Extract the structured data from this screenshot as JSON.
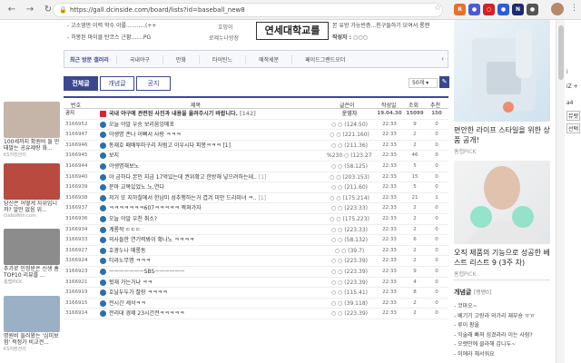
{
  "browser": {
    "url": "https://gall.dcinside.com/board/lists?id=baseball_new8",
    "extensions": [
      {
        "label": "R",
        "color": "#e8712d"
      },
      {
        "label": "●",
        "color": "#4a5bd4"
      },
      {
        "label": "○",
        "color": "#d42222"
      },
      {
        "label": "●",
        "color": "#2b5fd9"
      },
      {
        "label": "N",
        "color": "#1c2b6e"
      },
      {
        "label": "●",
        "color": "#555555"
      }
    ]
  },
  "top_list": {
    "left_items": [
      "- 고소영만 이력 학수 이를...........(++",
      "- 히봉된 마이클 탄코스 근황.......PG"
    ],
    "right_items": [
      "본 유방 가능빈층...친구들하기 모여서 롱캔",
      "작성자 : ○○○"
    ],
    "middle_labels": [
      "호밍이",
      "로제누나방장"
    ],
    "univ_banner": "연세대학교를"
  },
  "recent_bar": {
    "title": "최근 방문 갤러리",
    "items": [
      "국내야구",
      "만화",
      "타이틴느",
      "애작세분",
      "페이드그랜드오더"
    ]
  },
  "tabs": [
    "전체글",
    "개념글",
    "공지"
  ],
  "per_page": "50개",
  "write_icon": "pencil-icon",
  "columns": {
    "no": "번호",
    "subject": "제목",
    "writer": "글쓴이",
    "date": "작성일",
    "views": "조회",
    "rec": "추천"
  },
  "posts": [
    {
      "no": "공지",
      "subject": "국내 야구에 관련된 사진과 내용을 올려주시기 바랍니다.",
      "count": "[142]",
      "writer": "운영자",
      "date": "19.04.30",
      "views": "15099",
      "rec": "150",
      "notice": true
    },
    {
      "no": "3166952",
      "subject": "오늘 야알 우승 보리움잉메포",
      "count": "",
      "writer": "○ ○ (124.50)",
      "date": "22:33",
      "views": "9",
      "rec": "0"
    },
    {
      "no": "3166947",
      "subject": "야생명 존나 이뻐서 사랑 ㅋㅋㅋ",
      "count": "",
      "writer": "○ ○ (221.160)",
      "date": "22:33",
      "views": "2",
      "rec": "0"
    },
    {
      "no": "3166946",
      "subject": "동재호 패배투마구리 처럼고 이우시다 피봉ㅋㅋㅋ [1]",
      "count": "",
      "writer": "○ ○ (211.36)",
      "date": "22:33",
      "views": "2",
      "rec": "0"
    },
    {
      "no": "3166945",
      "subject": "보지",
      "count": "",
      "writer": "%230 ○ (123.274)",
      "date": "22:33",
      "views": "46",
      "rec": "0"
    },
    {
      "no": "3166944",
      "subject": "야생명해보노",
      "count": "",
      "writer": "○ ○ (58.125)",
      "date": "22:33",
      "views": "5",
      "rec": "0"
    },
    {
      "no": "3166940",
      "subject": "야 금하다 본인 지금 17억있는데 권위확고 한방해 넣으려하는데..",
      "count": "[1]",
      "writer": "○ ○ (203.153)",
      "date": "22:33",
      "views": "15",
      "rec": "0"
    },
    {
      "no": "3166939",
      "subject": "문마 교복있었노.노.연다",
      "count": "",
      "writer": "○ ○ (211.60)",
      "date": "22:33",
      "views": "5",
      "rec": "0"
    },
    {
      "no": "3166938",
      "subject": "저거 또 지하철에서 한남미 성추행하는거 겹겨 미만 드리미녀 ㅋ..",
      "count": "[1]",
      "writer": "○ ○ (175.214)",
      "date": "22:33",
      "views": "21",
      "rec": "1"
    },
    {
      "no": "3166937",
      "subject": "ㅋㅋㅋㅋㅋㅋㅋ607ㅋㅋㅋㅋㅋ 짝쳐가자",
      "count": "",
      "writer": "○ ○ (223.33)",
      "date": "22:33",
      "views": "2",
      "rec": "0"
    },
    {
      "no": "3166936",
      "subject": "오늘 야알 우천 취소?",
      "count": "",
      "writer": "○ ○ (175.223)",
      "date": "22:33",
      "views": "2",
      "rec": "0"
    },
    {
      "no": "3166934",
      "subject": "계룡작 ㄷㄷㄷ",
      "count": "",
      "writer": "○ ○ (223.33)",
      "date": "22:33",
      "views": "2",
      "rec": "0"
    },
    {
      "no": "3166933",
      "subject": "의사들한 연기력봐이 확나노 ㅋㅋㅋㅋ",
      "count": "",
      "writer": "○ ○ (58.132)",
      "date": "22:33",
      "views": "6",
      "rec": "0"
    },
    {
      "no": "3166927",
      "subject": "호광누나 메롱동",
      "count": "",
      "writer": "○ ○ (39.7)",
      "date": "22:33",
      "views": "2",
      "rec": "0"
    },
    {
      "no": "3166924",
      "subject": "티라노무명 ㅋㅋㅋ",
      "count": "",
      "writer": "○ ○ (223.39)",
      "date": "22:33",
      "views": "2",
      "rec": "0"
    },
    {
      "no": "3166923",
      "subject": "ㅡㅡㅡㅡㅡㅡㅡSBSㅡㅡㅡㅡㅡㅡ",
      "count": "",
      "writer": "○ ○ (223.39)",
      "date": "22:33",
      "views": "9",
      "rec": "0"
    },
    {
      "no": "3166921",
      "subject": "헛재 가는거냐 ㅋㅋ",
      "count": "",
      "writer": "○ ○ (223.39)",
      "date": "22:33",
      "views": "4",
      "rec": "0"
    },
    {
      "no": "3166919",
      "subject": "호날두두가 찰랑 ㅋㅋㅋㅋ",
      "count": "",
      "writer": "○ ○ (115.41)",
      "date": "22:33",
      "views": "8",
      "rec": "0"
    },
    {
      "no": "3166915",
      "subject": "전시간 세삭ㅋㅋ",
      "count": "",
      "writer": "○ ○ (39.118)",
      "date": "22:33",
      "views": "2",
      "rec": "0"
    },
    {
      "no": "3166914",
      "subject": "전리대 경제 23시간전ㅋㅋㅋㅋㅋ",
      "count": "",
      "writer": "○ ○ (223.39)",
      "date": "22:33",
      "views": "2",
      "rec": "0"
    }
  ],
  "left_ads": [
    {
      "caption": "100세까지 확원비 들 만태말는 공유제랑 화...",
      "source": "KS저장관리",
      "color": "#c4b5a8"
    },
    {
      "caption": "당신은 어떻게 자위입니까? 알만 없음 위...",
      "source": "iSideWith.com",
      "color": "#b84a40"
    },
    {
      "caption": "추가로 인정받은 신생 홈 TOP10 리뷰를 ...",
      "source": "홈랩PICK",
      "color": "#8c8c8c"
    },
    {
      "caption": "명원비 들러왔는 '심미보험' 적정가 비교견...",
      "source": "KS저장관리",
      "color": "#9bb0c4"
    }
  ],
  "right_ads": [
    {
      "title": "편안한 라이프 스타일을 위한 상품 공개!",
      "source": "홈랩PICK"
    },
    {
      "title": "오직 제품의 기능으로 성공한 베스트 리스트 9 (3주 차)",
      "source": "홈랩PICK"
    }
  ],
  "concept": {
    "title": "개념글",
    "sub": "[랭뱅0]",
    "items": [
      "- 코마오~",
      "- 베기기 고랑라 와가리 재부숑 ㅠㅠ",
      "- 루이 팡올",
      "- 익술래 빠져 섬겼라라 이는 사람?",
      "- 오랫만에 클라해 갑니두~",
      "- 미에라 채서워요"
    ]
  },
  "edge_labels": [
    "i",
    "iZ +",
    "a4",
    "뮤렛",
    "선택"
  ]
}
